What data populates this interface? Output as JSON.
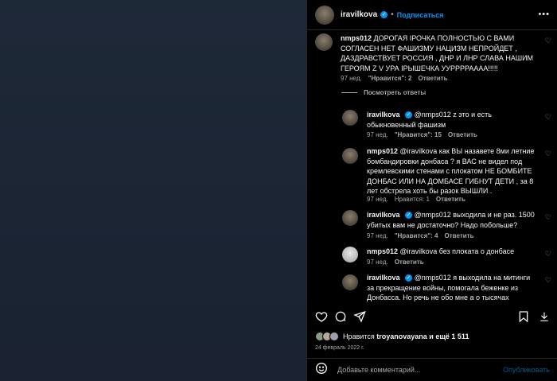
{
  "header": {
    "username": "iravilkova",
    "follow_label": "Подписаться",
    "separator": "•",
    "more": "•••"
  },
  "comments": [
    {
      "username": "nmps012",
      "text": "ДОРОГАЯ ІРОЧКА ПОЛНОСТЬЮ С ВАМИ СОГЛАСЕН НЕТ ФАШИЗМУ НАЦИЗМ НЕПРОЙДЕТ , ДАЗДРАВСТВУЕТ РОССИЯ , ДНР И ЛНР СЛАВА НАШИМ ГЕРОЯМ Z V УРА ІРЫШЕЧКА УУРРРРАААА!!!!!",
      "time": "97 нед.",
      "likes": "\"Нравится\": 2",
      "reply": "Ответить"
    }
  ],
  "view_replies": "Посмотреть ответы",
  "replies": [
    {
      "username": "iravilkova",
      "text": "@nmps012 z это и есть обыкновенный фашизм",
      "time": "97 нед.",
      "likes": "\"Нравится\": 15",
      "reply": "Ответить"
    },
    {
      "username": "nmps012",
      "text": "@iravilkova как ВЫ назавете 8ми летние бомбандировки донбаса ? я ВАС не видел под кремлевскими стенами с плокатом НЕ БОМБИТЕ ДОНБАС ИЛИ НА ДОМБАСЕ ГИБНУТ ДЕТИ , за 8 лет обстрела хоть бы разок ВЫШЛИ .",
      "time": "97 нед.",
      "likes": "Нравится: 1",
      "reply": "Ответить"
    },
    {
      "username": "iravilkova",
      "text": "@nmps012 выходила и не раз. 1500 убитых вам не достаточно? Надо побольше?",
      "time": "97 нед.",
      "likes": "\"Нравится\": 4",
      "reply": "Ответить"
    },
    {
      "username": "nmps012",
      "text": "@iravilkova без плоката о донбасе",
      "time": "97 нед.",
      "likes": "",
      "reply": "Ответить"
    },
    {
      "username": "iravilkova",
      "text": "@nmps012 я выходила на митинги за прекращение войны, помогала беженке из Донбасса. Но речь не обо мне а о тысячах",
      "time": "",
      "likes": "",
      "reply": ""
    }
  ],
  "likes_line": {
    "prefix": "Нравится",
    "user": "troyanovayana",
    "suffix": "и ещё 1 511"
  },
  "date": "24 февраль 2022 г.",
  "add_comment": {
    "placeholder": "Добавьте комментарий...",
    "post_label": "Опубликовать"
  },
  "icons": [
    "heart-icon",
    "comment-icon",
    "share-icon",
    "save-icon",
    "emoji-icon",
    "more-icon",
    "verified-icon"
  ]
}
